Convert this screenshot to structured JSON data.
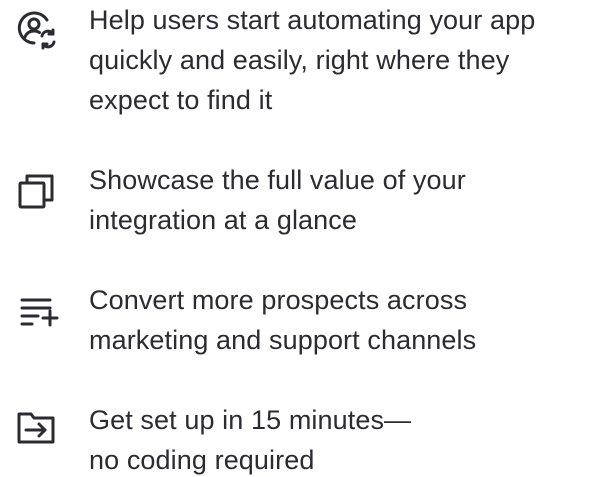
{
  "features": [
    {
      "icon": "user-sync-icon",
      "lines": [
        "Help users start automating your app",
        "quickly and easily, right where they",
        "expect to find it"
      ]
    },
    {
      "icon": "copy-icon",
      "lines": [
        "Showcase the full value of your",
        "integration at a glance"
      ]
    },
    {
      "icon": "playlist-add-icon",
      "lines": [
        "Convert more prospects across",
        "marketing and support channels"
      ]
    },
    {
      "icon": "folder-arrow-icon",
      "lines": [
        "Get set up in 15 minutes—",
        "no coding required"
      ]
    }
  ],
  "colors": {
    "text": "#2b2b33",
    "background": "#ffffff"
  }
}
